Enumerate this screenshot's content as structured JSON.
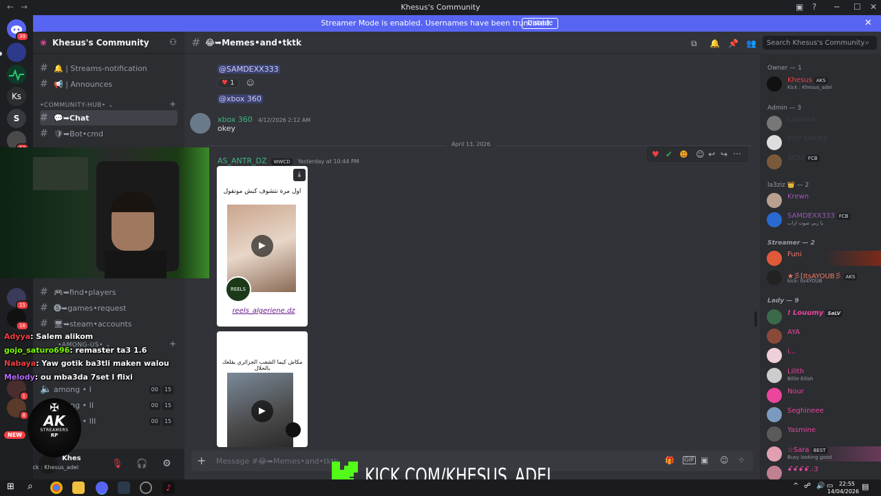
{
  "window": {
    "title": "Khesus's Community"
  },
  "banner": {
    "text": "Streamer Mode is enabled. Usernames have been truncated.",
    "button": "Disable"
  },
  "rail": {
    "badges": [
      "39",
      "12",
      "15",
      "16",
      "1",
      "8"
    ],
    "ks_label": "Ks",
    "new_label": "NEW"
  },
  "sidebar": {
    "server_name": "Khesus's Community",
    "channels_top": [
      {
        "label": "🔔 | Streams-notification"
      },
      {
        "label": "📢 | Announces"
      }
    ],
    "category_hub": "•COMMUNITY-HUB•",
    "channels_hub": [
      {
        "label": "💬➥Chat"
      },
      {
        "label": "🛡➥Bot•cmd"
      }
    ],
    "channels_mid": [
      {
        "label": "🎮➥find•players"
      },
      {
        "label": "🅢➥games•request"
      },
      {
        "label": "🖥➥steam•accounts"
      }
    ],
    "category_among": "•AMONG-US•",
    "voice": [
      {
        "label": "among • I",
        "n1": "00",
        "n2": "15"
      },
      {
        "label": "among • II",
        "n1": "00",
        "n2": "15"
      },
      {
        "label": "among • III",
        "n1": "00",
        "n2": "15"
      }
    ],
    "user": {
      "name": "Khes",
      "status": "Kick : Khesus_adel"
    }
  },
  "chat": {
    "channel": "😂➥Memes•and•tktk",
    "search_placeholder": "Search Khesus's Community",
    "mention1": "@SAMDEXX333",
    "reaction_count": "1",
    "mention2": "@xbox 360",
    "msg1": {
      "author": "xbox 360",
      "time": "4/12/2026 2:12 AM",
      "text": "okey"
    },
    "date_divider": "April 13, 2026",
    "msg2": {
      "author": "AS_ANTR_DZ",
      "tag": "WWCD",
      "time": "Yesterday at 10:44 PM",
      "media1_caption": "اول مرة نتشوف كبش مونقول",
      "media1_footer": "reels_algeriene.dz",
      "media1_logo": "REELS",
      "media2_caption": "مكاش كيما الشعب الجزائري يقلعك بالحلال"
    },
    "composer_placeholder": "Message #😂➥Memes•and•tktk"
  },
  "members": {
    "groups": [
      {
        "role": "Owner — 1",
        "items": [
          {
            "name": "Khesus",
            "tag": "AKS",
            "status": "Kick : Khesus_adel",
            "color": "#f23f43"
          }
        ]
      },
      {
        "role": "Admin — 3",
        "items": [
          {
            "name": "Labarsa",
            "tag": "",
            "status": "",
            "color": "#3a3c42"
          },
          {
            "name": "POP-SMOKE",
            "tag": "",
            "status": "",
            "color": "#3a3c42"
          },
          {
            "name": "ACIU",
            "tag": "FCB",
            "status": "",
            "color": "#3a3c42"
          }
        ]
      },
      {
        "role": "la3ziz 👑 — 2",
        "items": [
          {
            "name": "Krewn",
            "tag": "",
            "status": "",
            "color": "#9b59b6"
          },
          {
            "name": "SAMDEXX333",
            "tag": "FCB",
            "status": "يا ربي صوت اراب",
            "color": "#9b59b6"
          }
        ]
      },
      {
        "role": "Streamer — 2",
        "items": [
          {
            "name": "Funi",
            "tag": "",
            "status": "",
            "color": "#f47b67"
          },
          {
            "name": "★彡[ItsAYOUB彡",
            "tag": "AKS",
            "status": "kick: its4YOUB",
            "color": "#f47b67"
          }
        ]
      },
      {
        "role": "Lady — 9",
        "items": [
          {
            "name": "! Louumy",
            "tag": "SaLV",
            "status": "",
            "color": "#eb459e"
          },
          {
            "name": "AYA",
            "tag": "",
            "status": "",
            "color": "#eb459e"
          },
          {
            "name": "i...",
            "tag": "",
            "status": "",
            "color": "#eb459e"
          },
          {
            "name": "Lilith",
            "tag": "",
            "status": "Billie Eilish",
            "color": "#eb459e"
          },
          {
            "name": "Nour",
            "tag": "",
            "status": "",
            "color": "#eb459e"
          },
          {
            "name": "Seghineee",
            "tag": "",
            "status": "",
            "color": "#eb459e"
          },
          {
            "name": "Yasmine",
            "tag": "",
            "status": "",
            "color": "#eb459e"
          },
          {
            "name": "☆Sara",
            "tag": "BEST",
            "status": "Busy looking good",
            "color": "#eb459e"
          },
          {
            "name": "ꗃꗃꗃꗃ.:3",
            "tag": "",
            "status": "",
            "color": "#eb459e"
          }
        ]
      }
    ]
  },
  "overlay_chat": [
    {
      "user": "Adyya",
      "text": "Salem alikom",
      "color": "#f23f43"
    },
    {
      "user": "gojo_saturo696",
      "text": "remaster ta3 1.6",
      "color": "#7cfc00"
    },
    {
      "user": "Nabaya",
      "text": "Yaw gotik ba3tli maken walou",
      "color": "#f23f43"
    },
    {
      "user": "Melody",
      "text": "ou mba3da 7set l flixi",
      "color": "#b36bff"
    }
  ],
  "logo": {
    "line1": "AK",
    "line2": "STREAMERS",
    "line3": "RP"
  },
  "kick_banner": {
    "url": "KICK.COM/KHESUS_ADEL"
  },
  "taskbar": {
    "time": "22:55",
    "date": "14/04/2026"
  }
}
